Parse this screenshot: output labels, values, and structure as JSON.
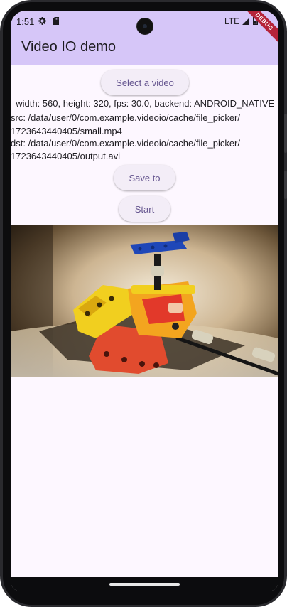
{
  "status_bar": {
    "time": "1:51",
    "network": "LTE",
    "icons": [
      "gear-icon",
      "sd-card-icon",
      "signal-icon",
      "battery-icon"
    ]
  },
  "debug_banner": "DEBUG",
  "app_bar": {
    "title": "Video IO demo",
    "color": "#d6c6f8"
  },
  "buttons": {
    "select_video": "Select a video",
    "save_to": "Save to",
    "start": "Start",
    "text_color": "#65558f",
    "background": "#f3edf7"
  },
  "video_info": {
    "properties": "  width: 560, height: 320, fps: 30.0, backend: ANDROID_NATIVE",
    "src_line1": "src: /data/user/0/com.example.videoio/cache/file_picker/",
    "src_line2": "1723643440405/small.mp4",
    "dst_line1": "dst: /data/user/0/com.example.videoio/cache/file_picker/",
    "dst_line2": "1723643440405/output.avi"
  },
  "preview": {
    "subject": "lego-technic-model-frame"
  },
  "background_color": "#fdf7ff"
}
